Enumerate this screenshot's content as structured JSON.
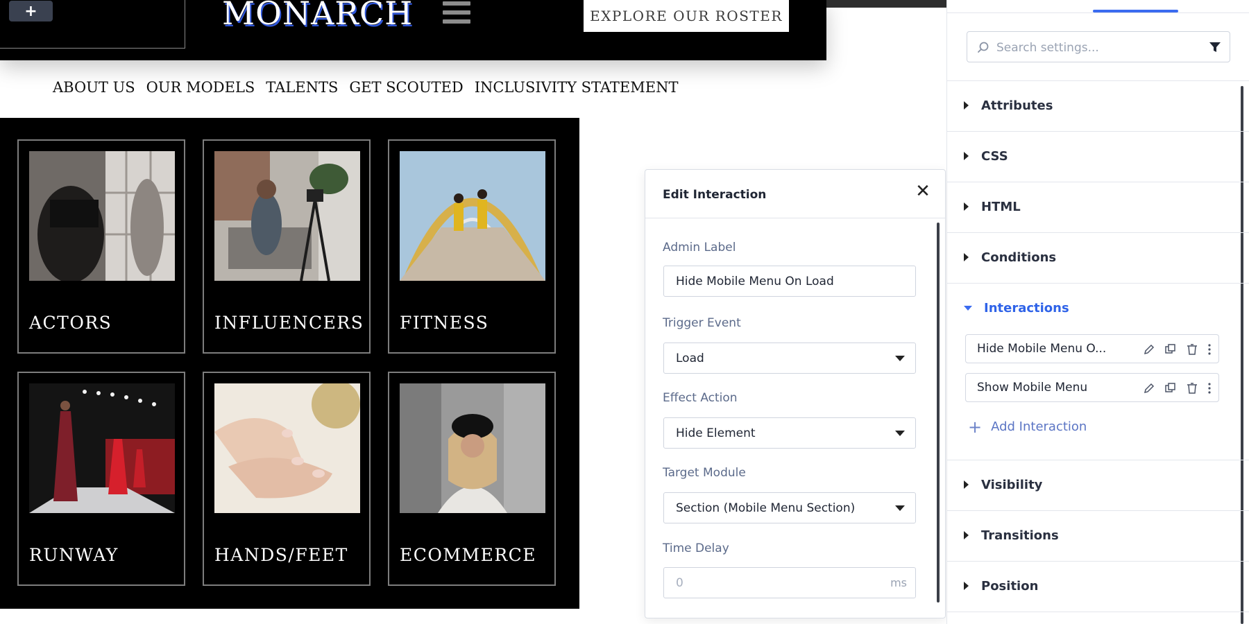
{
  "site": {
    "add_label": "+",
    "logo": "MONARCH",
    "explore_label": "EXPLORE OUR ROSTER",
    "nav": [
      "ABOUT US",
      "OUR MODELS",
      "TALENTS",
      "GET SCOUTED",
      "INCLUSIVITY STATEMENT"
    ],
    "cards": [
      "ACTORS",
      "INFLUENCERS",
      "FITNESS",
      "RUNWAY",
      "HANDS/FEET",
      "ECOMMERCE"
    ]
  },
  "modal": {
    "title": "Edit Interaction",
    "close": "✕",
    "admin_label": {
      "label": "Admin Label",
      "value": "Hide Mobile Menu On Load"
    },
    "trigger_event": {
      "label": "Trigger Event",
      "value": "Load"
    },
    "effect_action": {
      "label": "Effect Action",
      "value": "Hide Element"
    },
    "target_module": {
      "label": "Target Module",
      "value": "Section (Mobile Menu Section)"
    },
    "time_delay": {
      "label": "Time Delay",
      "placeholder": "0",
      "unit": "ms"
    }
  },
  "sidebar": {
    "search_placeholder": "Search settings...",
    "sections": {
      "attributes": "Attributes",
      "css": "CSS",
      "html": "HTML",
      "conditions": "Conditions",
      "interactions": "Interactions",
      "visibility": "Visibility",
      "transitions": "Transitions",
      "position": "Position"
    },
    "interactions": [
      "Hide Mobile Menu O...",
      "Show Mobile Menu"
    ],
    "add_interaction": "Add Interaction"
  },
  "colors": {
    "accent": "#2f63e8",
    "dark": "#000000",
    "logo_shadow": "#2f56d8"
  }
}
